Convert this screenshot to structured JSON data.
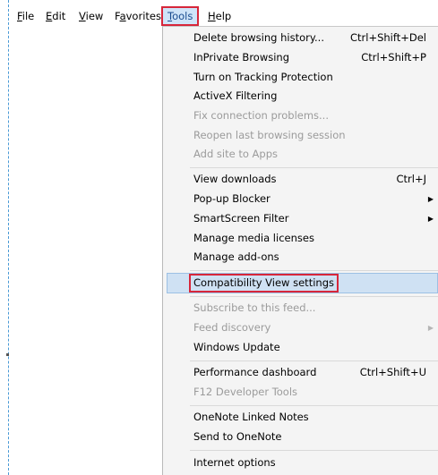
{
  "menubar": {
    "items": [
      {
        "key": "F",
        "rest": "ile"
      },
      {
        "key": "E",
        "rest": "dit"
      },
      {
        "key": "V",
        "rest": "iew"
      },
      {
        "pre": "F",
        "key": "a",
        "rest": "vorites"
      },
      {
        "key": "T",
        "rest": "ools"
      },
      {
        "key": "H",
        "rest": "elp"
      }
    ]
  },
  "tools_menu": {
    "items": [
      {
        "label": "Delete browsing history...",
        "shortcut": "Ctrl+Shift+Del",
        "enabled": true
      },
      {
        "label": "InPrivate Browsing",
        "shortcut": "Ctrl+Shift+P",
        "enabled": true
      },
      {
        "label": "Turn on Tracking Protection",
        "shortcut": "",
        "enabled": true
      },
      {
        "label": "ActiveX Filtering",
        "shortcut": "",
        "enabled": true
      },
      {
        "label": "Fix connection problems...",
        "shortcut": "",
        "enabled": false
      },
      {
        "label": "Reopen last browsing session",
        "shortcut": "",
        "enabled": false
      },
      {
        "label": "Add site to Apps",
        "shortcut": "",
        "enabled": false
      },
      {
        "label": "View downloads",
        "shortcut": "Ctrl+J",
        "enabled": true
      },
      {
        "label": "Pop-up Blocker",
        "shortcut": "",
        "enabled": true,
        "submenu": true
      },
      {
        "label": "SmartScreen Filter",
        "shortcut": "",
        "enabled": true,
        "submenu": true
      },
      {
        "label": "Manage media licenses",
        "shortcut": "",
        "enabled": true
      },
      {
        "label": "Manage add-ons",
        "shortcut": "",
        "enabled": true
      },
      {
        "label": "Compatibility View settings",
        "shortcut": "",
        "enabled": true,
        "highlighted": true
      },
      {
        "label": "Subscribe to this feed...",
        "shortcut": "",
        "enabled": false
      },
      {
        "label": "Feed discovery",
        "shortcut": "",
        "enabled": false,
        "submenu": true
      },
      {
        "label": "Windows Update",
        "shortcut": "",
        "enabled": true
      },
      {
        "label": "Performance dashboard",
        "shortcut": "Ctrl+Shift+U",
        "enabled": true
      },
      {
        "label": "F12 Developer Tools",
        "shortcut": "",
        "enabled": false
      },
      {
        "label": "OneNote Linked Notes",
        "shortcut": "",
        "enabled": true
      },
      {
        "label": "Send to OneNote",
        "shortcut": "",
        "enabled": true
      },
      {
        "label": "Internet options",
        "shortcut": "",
        "enabled": true
      }
    ],
    "submenu_arrow": "▶"
  },
  "colors": {
    "highlight_border": "#d7263a",
    "hover_fill": "#cfe1f3",
    "disabled_text": "#9b9b9b",
    "menu_background": "#f4f4f4"
  }
}
